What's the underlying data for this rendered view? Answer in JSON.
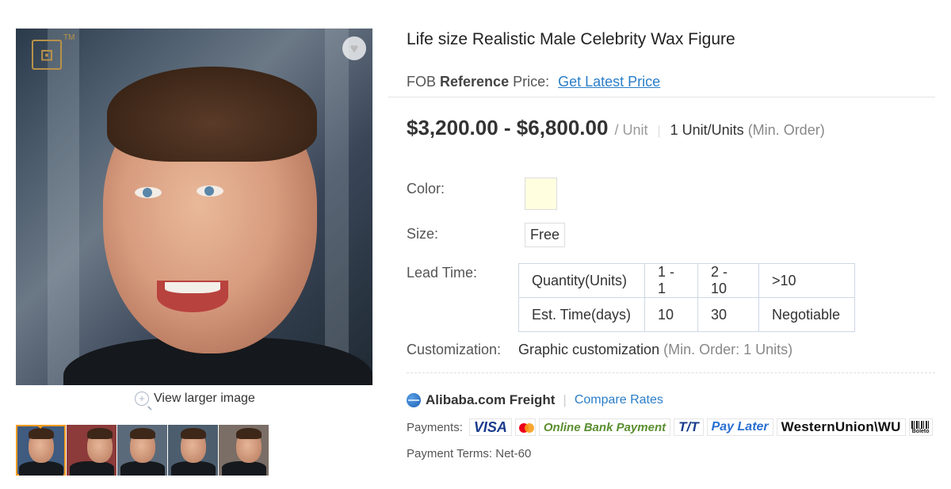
{
  "gallery": {
    "logo_text": "⊡",
    "logo_tm": "TM",
    "favorite_icon": "heart-icon",
    "view_larger_label": "View larger image",
    "thumbnail_count": 5
  },
  "product": {
    "title": "Life size Realistic Male Celebrity Wax Figure",
    "fob_prefix": "FOB",
    "fob_bold": "Reference",
    "fob_suffix": "Price:",
    "get_price_link": "Get Latest Price",
    "price_range": "$3,200.00 - $6,800.00",
    "price_unit": "/ Unit",
    "moq_value": "1 Unit/Units",
    "moq_note": "(Min. Order)"
  },
  "attributes": {
    "color_label": "Color:",
    "color_value": "#ffffe0",
    "size_label": "Size:",
    "size_value": "Free",
    "lead_time_label": "Lead Time:",
    "lead_table": {
      "row1": [
        "Quantity(Units)",
        "1 - 1",
        "2 - 10",
        ">10"
      ],
      "row2": [
        "Est. Time(days)",
        "10",
        "30",
        "Negotiable"
      ]
    },
    "customization_label": "Customization:",
    "customization_value": "Graphic customization",
    "customization_note": "(Min. Order: 1 Units)"
  },
  "freight": {
    "brand": "Alibaba.com Freight",
    "separator": "|",
    "compare_link": "Compare Rates"
  },
  "payments": {
    "label": "Payments:",
    "methods": [
      "VISA",
      "mastercard-icon",
      "Online Bank Payment",
      "T/T",
      "Pay Later",
      "WesternUnion WU",
      "Boleto"
    ],
    "visa": "VISA",
    "online_bank": "Online Bank Payment",
    "tt": "T/T",
    "pay_later": "Pay Later",
    "western_union": "WesternUnion\\WU",
    "boleto": "Boleto"
  },
  "terms": {
    "text": "Payment Terms: Net-60"
  },
  "colors": {
    "link": "#2a7ec8",
    "active_thumb": "#f39a1e",
    "table_border": "#cfd8e6"
  }
}
